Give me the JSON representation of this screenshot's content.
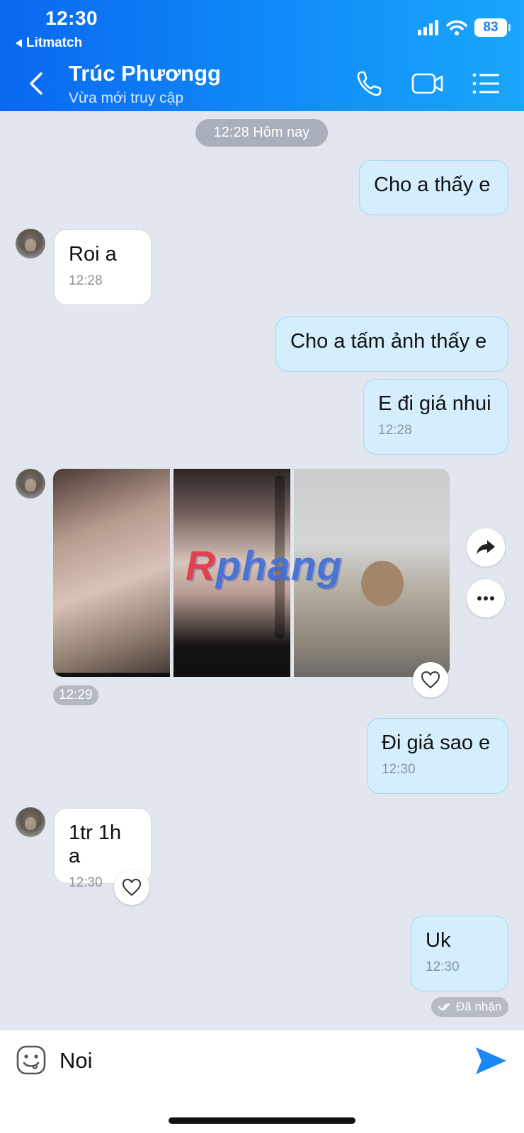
{
  "status_bar": {
    "time": "12:30",
    "back_app": "Litmatch",
    "battery": "83"
  },
  "header": {
    "name": "Trúc Phươngg",
    "status": "Vừa mới truy cập"
  },
  "date_divider": "12:28 Hôm nay",
  "messages": [
    {
      "dir": "out",
      "text": "Cho a thấy e",
      "time": ""
    },
    {
      "dir": "in",
      "text": "Roi a",
      "time": "12:28"
    },
    {
      "dir": "out",
      "text": "Cho a tấm ảnh thấy e",
      "time": ""
    },
    {
      "dir": "out",
      "text": "E đi giá nhui",
      "time": "12:28"
    },
    {
      "dir": "in",
      "type": "photos",
      "count": 3,
      "time": "12:29"
    },
    {
      "dir": "out",
      "text": "Đi giá sao e",
      "time": "12:30"
    },
    {
      "dir": "in",
      "text": "1tr 1h a",
      "time": "12:30"
    },
    {
      "dir": "out",
      "text": "Uk",
      "time": "12:30"
    }
  ],
  "watermark": {
    "first": "R",
    "rest": "phang"
  },
  "delivery_status": "Đã nhận",
  "composer": {
    "value": "Noi"
  },
  "icons": [
    "back-chevron-icon",
    "phone-icon",
    "video-camera-icon",
    "list-menu-icon",
    "share-forward-icon",
    "more-icon",
    "heart-icon",
    "sticker-emoji-icon",
    "send-icon"
  ],
  "colors": {
    "header_start": "#0a68f0",
    "header_end": "#1aa6fb",
    "bubble_out": "#d4eefd",
    "bubble_in": "#ffffff",
    "chat_bg": "#e2e7ef",
    "send": "#1b86f5"
  }
}
